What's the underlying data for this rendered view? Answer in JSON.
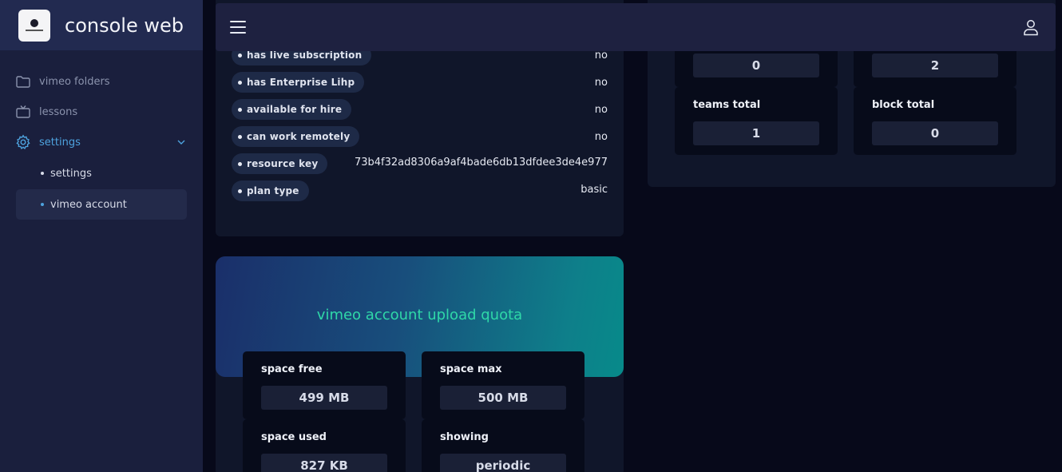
{
  "app": {
    "title": "console web"
  },
  "sidebar": {
    "items": [
      {
        "label": "vimeo folders",
        "icon": "folder-icon"
      },
      {
        "label": "lessons",
        "icon": "tv-icon"
      },
      {
        "label": "settings",
        "icon": "gear-icon"
      }
    ],
    "sub_items": [
      {
        "label": "settings"
      },
      {
        "label": "vimeo account"
      }
    ]
  },
  "info": {
    "rows": [
      {
        "key": "has live subscription",
        "value": "no"
      },
      {
        "key": "has Enterprise Lihp",
        "value": "no"
      },
      {
        "key": "available for hire",
        "value": "no"
      },
      {
        "key": "can work remotely",
        "value": "no"
      },
      {
        "key": "resource key",
        "value": "73b4f32ad8306a9af4bade6db13dfdee3de4e977"
      },
      {
        "key": "plan type",
        "value": "basic"
      }
    ]
  },
  "quota": {
    "title": "vimeo account upload quota",
    "stats": [
      {
        "label": "space free",
        "value": "499 MB"
      },
      {
        "label": "space max",
        "value": "500 MB"
      },
      {
        "label": "space used",
        "value": "827 KB"
      },
      {
        "label": "showing",
        "value": "periodic"
      }
    ]
  },
  "right_stats": [
    {
      "label": "",
      "value": "0"
    },
    {
      "label": "",
      "value": "2"
    },
    {
      "label": "teams total",
      "value": "1"
    },
    {
      "label": "block total",
      "value": "0"
    }
  ],
  "colors": {
    "background": "#07091a",
    "sidebar": "#1a1f3d",
    "card": "#10162a",
    "accent": "#4ea3df",
    "quota_title": "#2fd8a8"
  }
}
